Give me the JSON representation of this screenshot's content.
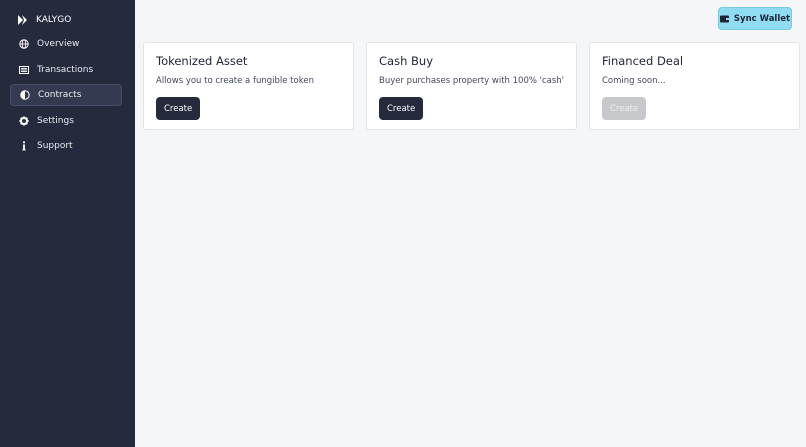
{
  "sidebar": {
    "brand": {
      "label": "KALYGO",
      "icon": "kalygo-logo-icon"
    },
    "items": [
      {
        "label": "Overview",
        "icon": "globe-icon",
        "active": false
      },
      {
        "label": "Transactions",
        "icon": "list-icon",
        "active": false
      },
      {
        "label": "Contracts",
        "icon": "half-circle-icon",
        "active": true
      },
      {
        "label": "Settings",
        "icon": "gear-icon",
        "active": false
      },
      {
        "label": "Support",
        "icon": "info-icon",
        "active": false
      }
    ]
  },
  "header": {
    "sync_label": "Sync Wallet",
    "sync_icon": "wallet-icon"
  },
  "cards": [
    {
      "title": "Tokenized Asset",
      "description": "Allows you to create a fungible token",
      "button": "Create",
      "enabled": true
    },
    {
      "title": "Cash Buy",
      "description": "Buyer purchases property with 100% 'cash'",
      "button": "Create",
      "enabled": true
    },
    {
      "title": "Financed Deal",
      "description": "Coming soon...",
      "button": "Create",
      "enabled": false
    }
  ],
  "colors": {
    "sidebar_bg": "#252a3d",
    "accent": "#8fdcf3",
    "button_dark": "#252a3d",
    "button_disabled": "#c6c8cc"
  }
}
